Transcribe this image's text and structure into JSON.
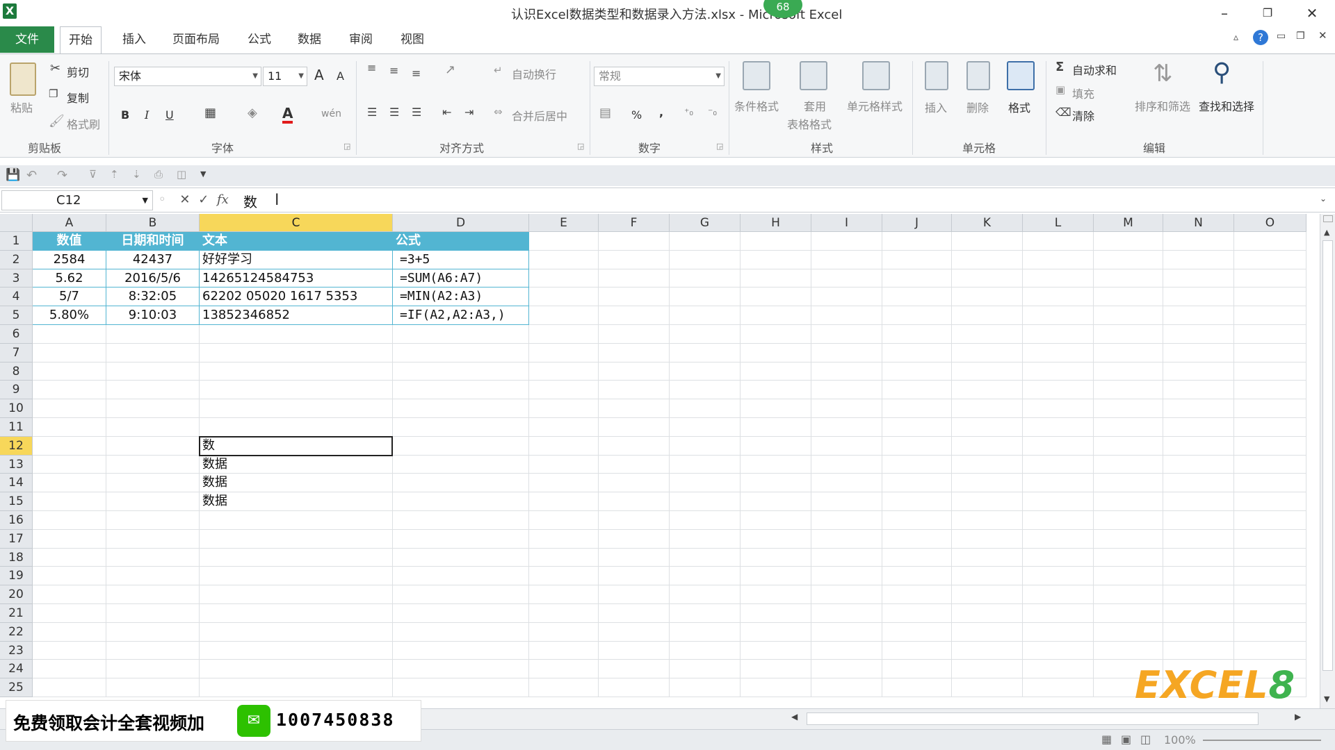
{
  "window": {
    "title": "认识Excel数据类型和数据录入方法.xlsx - Microsoft Excel",
    "badge": "68",
    "app_icon": "X"
  },
  "menu": {
    "file": "文件",
    "tabs": [
      "开始",
      "插入",
      "页面布局",
      "公式",
      "数据",
      "审阅",
      "视图"
    ],
    "active": "开始"
  },
  "ribbon": {
    "clipboard": {
      "paste": "粘贴",
      "cut": "剪切",
      "copy": "复制",
      "format_painter": "格式刷",
      "title": "剪贴板"
    },
    "font": {
      "name": "宋体",
      "size": "11",
      "bold": "B",
      "italic": "I",
      "underline": "U",
      "font_color_glyph": "A",
      "grow": "A",
      "shrink": "A",
      "wen": "wén",
      "title": "字体",
      "font_color": "#e11b1b"
    },
    "alignment": {
      "wrap": "自动换行",
      "merge": "合并后居中",
      "title": "对齐方式"
    },
    "number": {
      "format": "常规",
      "percent": "%",
      "comma": ",",
      "title": "数字"
    },
    "styles": {
      "conditional": "条件格式",
      "table_l1": "套用",
      "table_l2": "表格格式",
      "cell_styles": "单元格样式",
      "title": "样式"
    },
    "cells": {
      "insert": "插入",
      "delete": "删除",
      "format": "格式",
      "title": "单元格"
    },
    "editing": {
      "autosum": "自动求和",
      "fill": "填充",
      "clear": "清除",
      "sort": "排序和筛选",
      "find": "查找和选择",
      "title": "编辑"
    }
  },
  "formula_bar": {
    "name_box": "C12",
    "fx": "fx",
    "content": "数"
  },
  "sheet": {
    "columns": [
      "A",
      "B",
      "C",
      "D",
      "E",
      "F",
      "G",
      "H",
      "I",
      "J",
      "K",
      "L",
      "M",
      "N",
      "O"
    ],
    "selected_col": "C",
    "selected_row": 12,
    "rows": 25,
    "header_row": [
      "数值",
      "日期和时间",
      "文本",
      "公式"
    ],
    "data": [
      [
        "2584",
        "42437",
        "好好学习",
        "=3+5"
      ],
      [
        "5.62",
        "2016/5/6",
        "14265124584753",
        "=SUM(A6:A7)"
      ],
      [
        "5/7",
        "8:32:05",
        "62202 05020 1617 5353",
        "=MIN(A2:A3)"
      ],
      [
        "5.80%",
        "9:10:03",
        "13852346852",
        "=IF(A2,A2:A3,)"
      ]
    ],
    "c_column_entries": [
      {
        "row": 12,
        "value": "数"
      },
      {
        "row": 13,
        "value": "数据"
      },
      {
        "row": 14,
        "value": "数据"
      },
      {
        "row": 15,
        "value": "数据"
      }
    ],
    "header_fill": "#52b5d2"
  },
  "status": {
    "zoom": "100%"
  },
  "promo": {
    "text": "免费领取会计全套视频加",
    "number": "1007450838"
  },
  "logo": {
    "main": "EXCEL",
    "digit": "8"
  }
}
